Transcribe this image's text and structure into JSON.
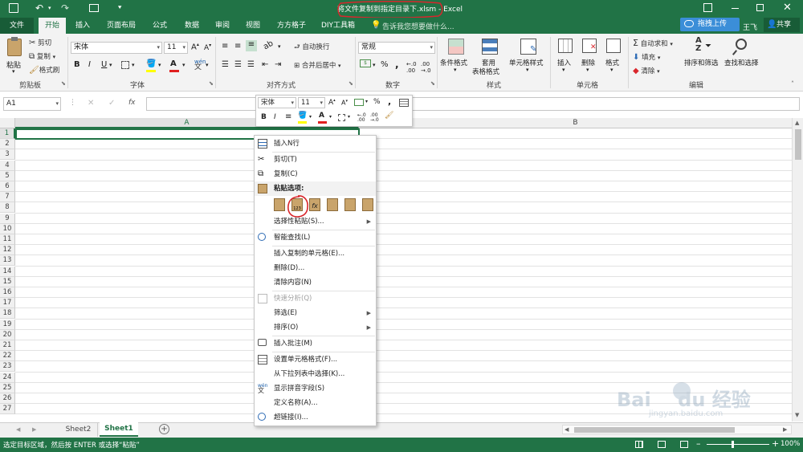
{
  "title": {
    "filename": "将文件复制到指定目录下.xlsm",
    "separator": " - ",
    "app": "Excel"
  },
  "user": {
    "upload_button": "拖拽上传",
    "name": "王飞",
    "share": "共享"
  },
  "tabs": [
    "文件",
    "开始",
    "插入",
    "页面布局",
    "公式",
    "数据",
    "审阅",
    "视图",
    "方方格子",
    "DIY工具箱"
  ],
  "tell_me": "告诉我您想要做什么...",
  "ribbon": {
    "clipboard": {
      "paste": "粘贴",
      "cut": "剪切",
      "copy": "复制",
      "format_painter": "格式刷",
      "label": "剪贴板"
    },
    "font": {
      "name": "宋体",
      "size": "11",
      "bold": "B",
      "italic": "I",
      "underline": "U",
      "label": "字体"
    },
    "alignment": {
      "wrap": "自动换行",
      "merge": "合并后居中",
      "label": "对齐方式"
    },
    "number": {
      "format": "常规",
      "percent": "%",
      "comma": ",",
      "label": "数字"
    },
    "styles": {
      "conditional": "条件格式",
      "table1": "套用",
      "table2": "表格格式",
      "cell_styles": "单元格样式",
      "label": "样式"
    },
    "cells": {
      "insert": "插入",
      "delete": "删除",
      "format": "格式",
      "label": "单元格"
    },
    "editing": {
      "autosum": "自动求和",
      "fill": "填充",
      "clear": "清除",
      "sort": "排序和筛选",
      "find": "查找和选择",
      "label": "编辑"
    }
  },
  "formula_bar": {
    "name_box": "A1",
    "fx": "fx"
  },
  "columns": [
    "A",
    "B"
  ],
  "rows": [
    "1",
    "2",
    "3",
    "4",
    "5",
    "6",
    "7",
    "8",
    "9",
    "10",
    "11",
    "12",
    "13",
    "14",
    "15",
    "16",
    "17",
    "18",
    "19",
    "20",
    "21",
    "22",
    "23",
    "24",
    "25",
    "26",
    "27"
  ],
  "mini_toolbar": {
    "font": "宋体",
    "size": "11",
    "percent": "%",
    "comma": ",",
    "bold": "B",
    "italic": "I"
  },
  "context_menu": {
    "insert_rows": "插入N行",
    "cut": "剪切(T)",
    "copy": "复制(C)",
    "paste_options": "粘贴选项:",
    "paste_special": "选择性粘贴(S)...",
    "smart_lookup": "智能查找(L)",
    "insert_copied": "插入复制的单元格(E)...",
    "delete": "删除(D)...",
    "clear": "清除内容(N)",
    "quick_analysis": "快速分析(Q)",
    "filter": "筛选(E)",
    "sort": "排序(O)",
    "insert_comment": "插入批注(M)",
    "format_cells": "设置单元格格式(F)...",
    "pick_list": "从下拉列表中选择(K)...",
    "phonetic": "显示拼音字段(S)",
    "define_name": "定义名称(A)...",
    "hyperlink": "超链接(I)..."
  },
  "sheets": [
    "Sheet2",
    "Sheet1"
  ],
  "status": {
    "message": "选定目标区域，然后按 ENTER 或选择“粘贴”",
    "zoom": "100%"
  },
  "colors": {
    "excel_green": "#217346",
    "annotation_red": "#d9262c",
    "grid": "#e2e2e2"
  }
}
